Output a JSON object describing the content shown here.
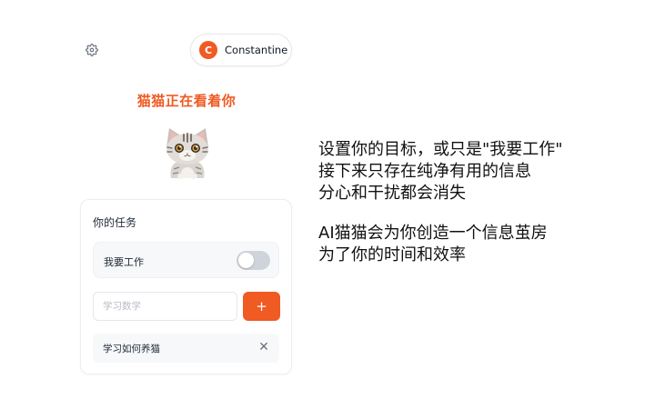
{
  "toolbar": {
    "settings_icon": "gear-icon"
  },
  "user": {
    "initial": "C",
    "name": "Constantine",
    "avatar_color": "#f05a23"
  },
  "heading": "猫猫正在看着你",
  "mascot_icon": "cat-icon",
  "tasks_card": {
    "title": "你的任务",
    "work_mode": {
      "label": "我要工作",
      "enabled": false
    },
    "new_task": {
      "value": "",
      "placeholder": "学习数学",
      "add_label": "+"
    },
    "items": [
      {
        "label": "学习如何养猫",
        "remove_icon": "close-icon",
        "remove_glyph": "✕"
      }
    ]
  },
  "description": {
    "lines": [
      "设置你的目标，或只是\"我要工作\"",
      "接下来只存在纯净有用的信息",
      "分心和干扰都会消失",
      "AI猫猫会为你创造一个信息茧房",
      "为了你的时间和效率"
    ]
  },
  "colors": {
    "accent": "#f05a23",
    "toggle_off": "#cfd4db",
    "row_bg": "#f7f8fa"
  }
}
